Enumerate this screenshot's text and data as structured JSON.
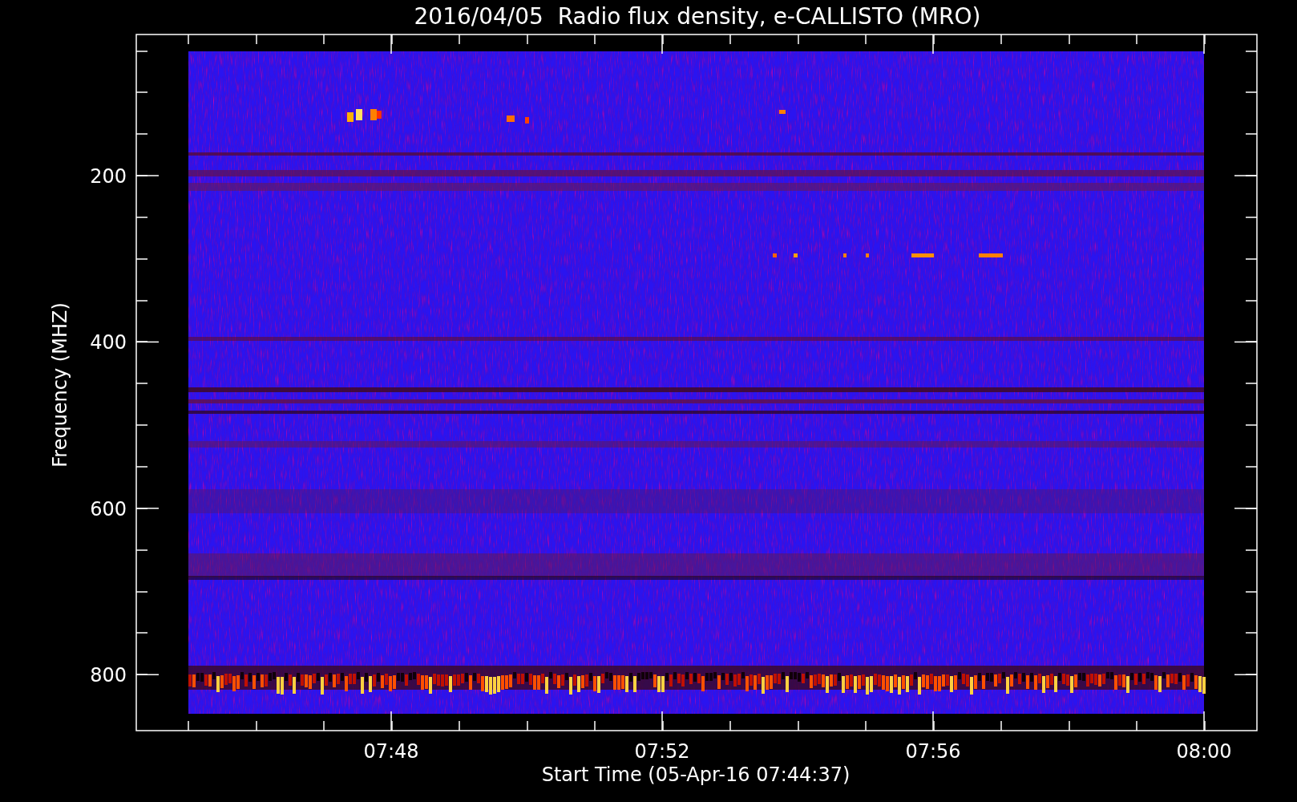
{
  "title": "2016/04/05  Radio flux density, e-CALLISTO (MRO)",
  "y_axis": {
    "label": "Frequency (MHZ)",
    "ticks": [
      "200",
      "400",
      "600",
      "800"
    ]
  },
  "x_axis": {
    "label": "Start Time (05-Apr-16 07:44:37)",
    "ticks": [
      "07:48",
      "07:52",
      "07:56",
      "08:00"
    ]
  }
}
